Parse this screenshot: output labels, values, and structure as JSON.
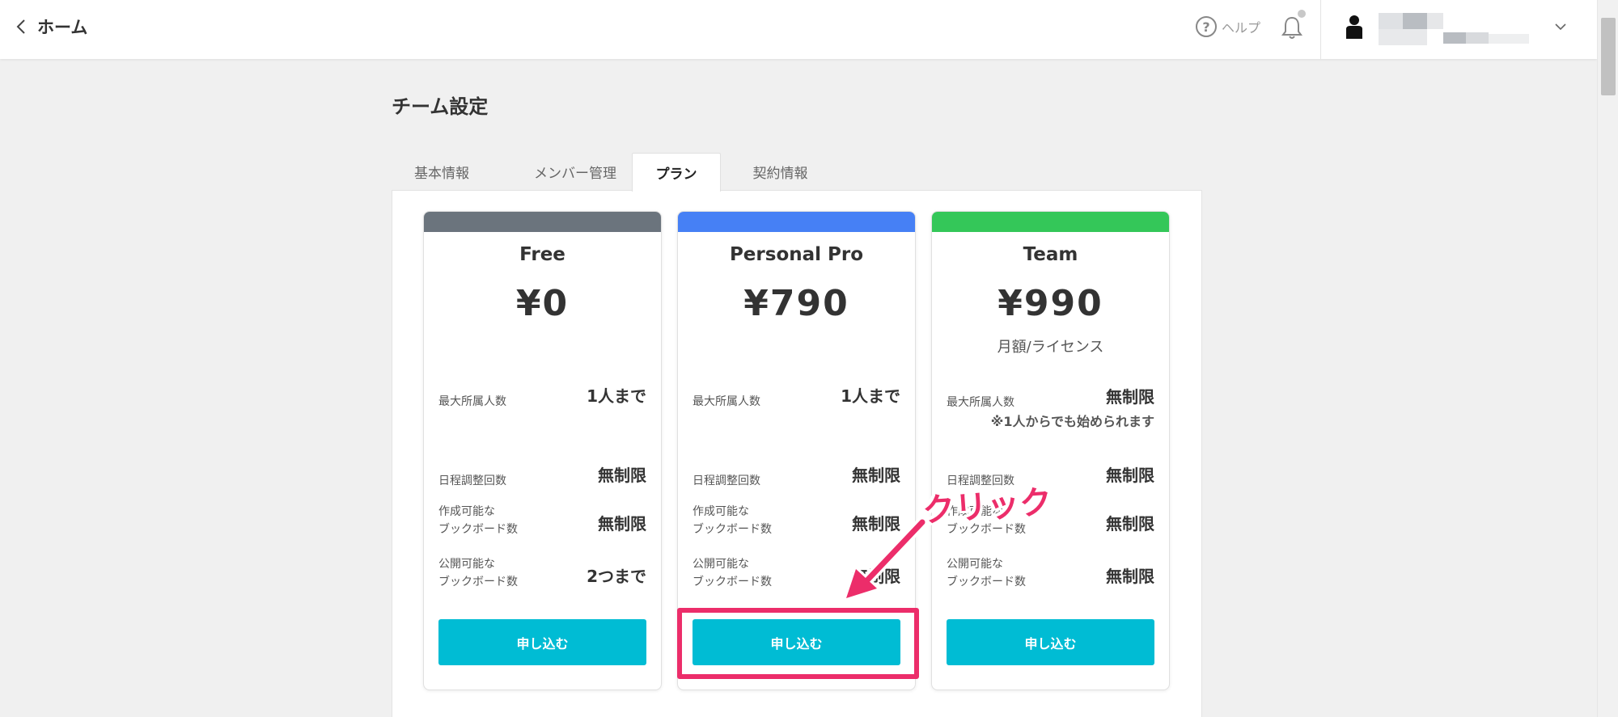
{
  "header": {
    "back_label": "ホーム",
    "help_label": "ヘルプ",
    "help_symbol": "?"
  },
  "page": {
    "title": "チーム設定"
  },
  "tabs": [
    {
      "label": "基本情報",
      "active": false
    },
    {
      "label": "メンバー管理",
      "active": false
    },
    {
      "label": "プラン",
      "active": true
    },
    {
      "label": "契約情報",
      "active": false
    }
  ],
  "plans": [
    {
      "name": "Free",
      "price": "¥0",
      "subtext": "",
      "bar_color": "#6b747d",
      "features": [
        {
          "label_lines": [
            "最大所属人数"
          ],
          "value": "1人まで",
          "note": ""
        },
        {
          "label_lines": [
            "日程調整回数"
          ],
          "value": "無制限",
          "note": ""
        },
        {
          "label_lines": [
            "作成可能な",
            "ブックボード数"
          ],
          "value": "無制限",
          "note": ""
        },
        {
          "label_lines": [
            "公開可能な",
            "ブックボード数"
          ],
          "value": "2つまで",
          "note": ""
        }
      ],
      "button_label": "申し込む"
    },
    {
      "name": "Personal Pro",
      "price": "¥790",
      "subtext": "",
      "bar_color": "#4680f5",
      "features": [
        {
          "label_lines": [
            "最大所属人数"
          ],
          "value": "1人まで",
          "note": ""
        },
        {
          "label_lines": [
            "日程調整回数"
          ],
          "value": "無制限",
          "note": ""
        },
        {
          "label_lines": [
            "作成可能な",
            "ブックボード数"
          ],
          "value": "無制限",
          "note": ""
        },
        {
          "label_lines": [
            "公開可能な",
            "ブックボード数"
          ],
          "value": "無制限",
          "note": ""
        }
      ],
      "button_label": "申し込む"
    },
    {
      "name": "Team",
      "price": "¥990",
      "subtext": "月額/ライセンス",
      "bar_color": "#34c759",
      "features": [
        {
          "label_lines": [
            "最大所属人数"
          ],
          "value": "無制限",
          "note": "※1人からでも始められます"
        },
        {
          "label_lines": [
            "日程調整回数"
          ],
          "value": "無制限",
          "note": ""
        },
        {
          "label_lines": [
            "作成可能な",
            "ブックボード数"
          ],
          "value": "無制限",
          "note": ""
        },
        {
          "label_lines": [
            "公開可能な",
            "ブックボード数"
          ],
          "value": "無制限",
          "note": ""
        }
      ],
      "button_label": "申し込む"
    }
  ],
  "annotation": {
    "text": "クリック",
    "color": "#ec2d6a"
  },
  "colors": {
    "button": "#00bcd4"
  }
}
